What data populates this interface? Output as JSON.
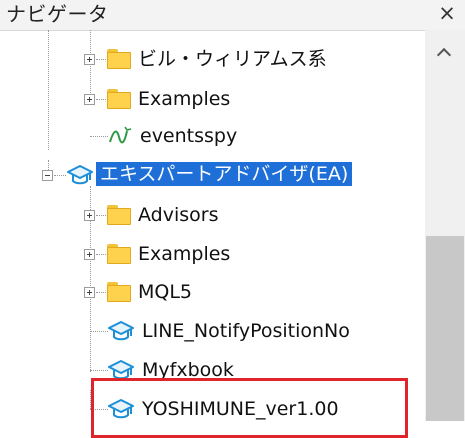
{
  "window": {
    "title": "ナビゲータ",
    "close_symbol": "×"
  },
  "tree": {
    "items": [
      {
        "label": "ビル・ウィリアムス系",
        "icon": "folder-icon",
        "expander": "plus"
      },
      {
        "label": "Examples",
        "icon": "folder-icon",
        "expander": "plus"
      },
      {
        "label": "eventsspy",
        "icon": "script-icon",
        "expander": "none"
      },
      {
        "label": "エキスパートアドバイザ(EA)",
        "icon": "graduation-cap-icon",
        "expander": "minus",
        "selected": true
      },
      {
        "label": "Advisors",
        "icon": "folder-icon",
        "expander": "plus"
      },
      {
        "label": "Examples",
        "icon": "folder-icon",
        "expander": "plus"
      },
      {
        "label": "MQL5",
        "icon": "folder-icon",
        "expander": "plus"
      },
      {
        "label": "LINE_NotifyPositionNo",
        "icon": "graduation-cap-icon",
        "expander": "none"
      },
      {
        "label": "Myfxbook",
        "icon": "graduation-cap-icon",
        "expander": "none"
      },
      {
        "label": "YOSHIMUNE_ver1.00",
        "icon": "graduation-cap-icon",
        "expander": "none",
        "highlighted": true
      }
    ]
  },
  "colors": {
    "selection": "#1e6fd8",
    "highlight_border": "#e0242b",
    "folder": "#ffd24d",
    "cap": "#1c8fd6"
  }
}
